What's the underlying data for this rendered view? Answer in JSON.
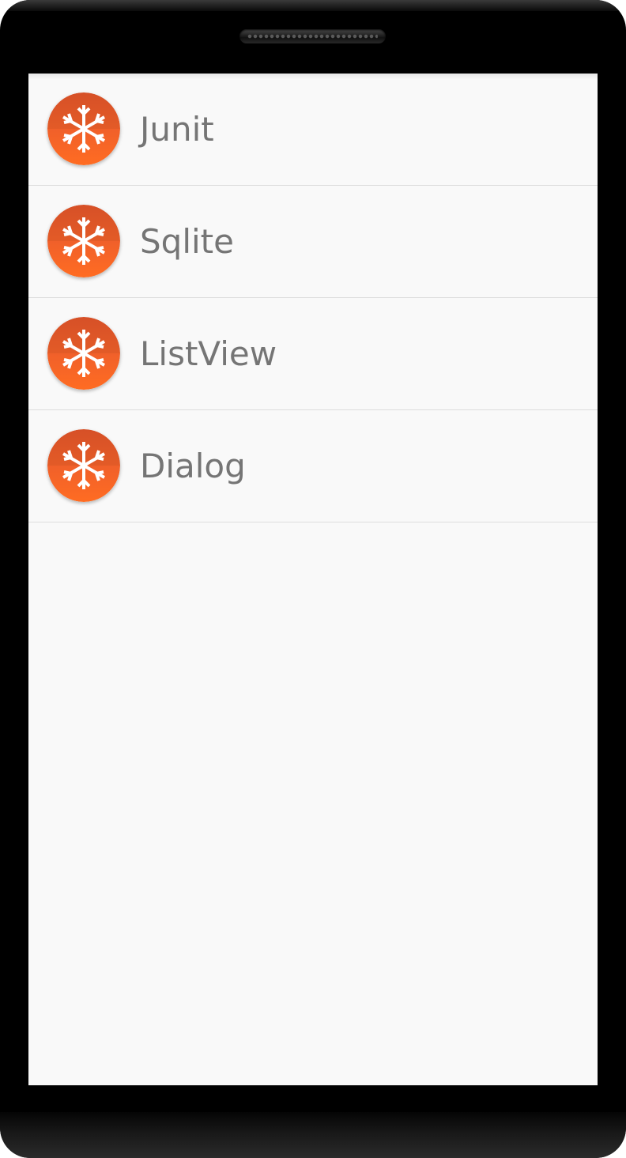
{
  "list": {
    "items": [
      {
        "label": "Junit",
        "icon": "snowflake-icon"
      },
      {
        "label": "Sqlite",
        "icon": "snowflake-icon"
      },
      {
        "label": "ListView",
        "icon": "snowflake-icon"
      },
      {
        "label": "Dialog",
        "icon": "snowflake-icon"
      }
    ]
  },
  "colors": {
    "screen_background": "#f9f9f9",
    "icon_top": "#e85a26",
    "icon_bottom": "#ff6a24",
    "icon_glyph": "#ffffff",
    "label_text": "#757575",
    "divider": "#dddddd",
    "device_frame": "#000000"
  }
}
